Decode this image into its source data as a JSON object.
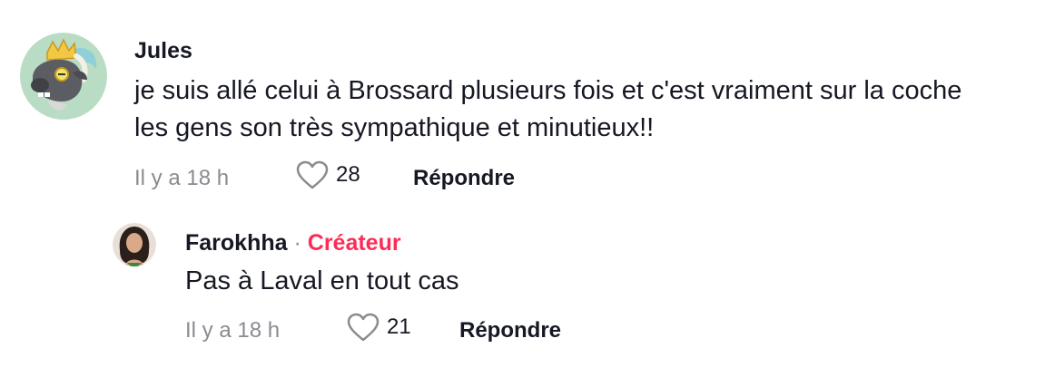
{
  "comments": [
    {
      "author": "Jules",
      "text": "je suis allé celui à Brossard plusieurs fois et c'est vraiment sur la coche les gens son très sympathique et minutieux!!",
      "time": "Il y a 18 h",
      "likes": "28",
      "reply_label": "Répondre"
    },
    {
      "author": "Farokhha",
      "separator": "·",
      "creator_badge": "Créateur",
      "text": "Pas à Laval en tout cas",
      "time": "Il y a 18 h",
      "likes": "21",
      "reply_label": "Répondre"
    }
  ],
  "icons": {
    "like": "heart-outline-icon"
  },
  "colors": {
    "creator": "#fe2c55",
    "muted": "#8a8b91",
    "text": "#161823"
  }
}
